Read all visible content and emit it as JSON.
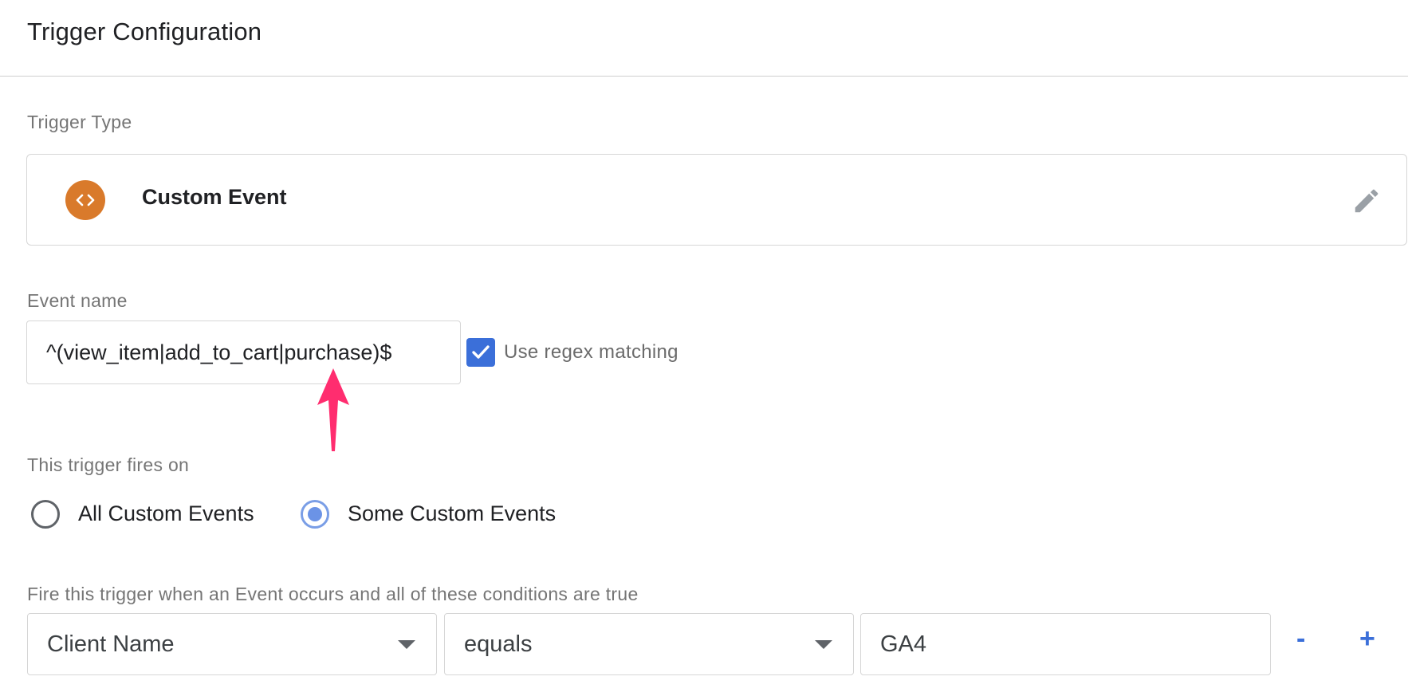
{
  "header": {
    "title": "Trigger Configuration"
  },
  "trigger_type": {
    "section_label": "Trigger Type",
    "name": "Custom Event",
    "icon": "code-brackets-icon",
    "icon_color": "#d97a2b",
    "edit_icon": "pencil-icon"
  },
  "event_name": {
    "label": "Event name",
    "value": "^(view_item|add_to_cart|purchase)$",
    "regex_checked": true,
    "regex_label": "Use regex matching"
  },
  "fires_on": {
    "label": "This trigger fires on",
    "options": [
      {
        "label": "All Custom Events",
        "selected": false
      },
      {
        "label": "Some Custom Events",
        "selected": true
      }
    ]
  },
  "conditions": {
    "label": "Fire this trigger when an Event occurs and all of these conditions are true",
    "rows": [
      {
        "variable": "Client Name",
        "operator": "equals",
        "value": "GA4"
      }
    ],
    "remove_label": "-",
    "add_label": "+"
  },
  "annotation": {
    "arrow_color": "#ff2d6f"
  },
  "colors": {
    "accent": "#3b6fd9",
    "border": "#d6d6d6",
    "label": "#757575"
  }
}
